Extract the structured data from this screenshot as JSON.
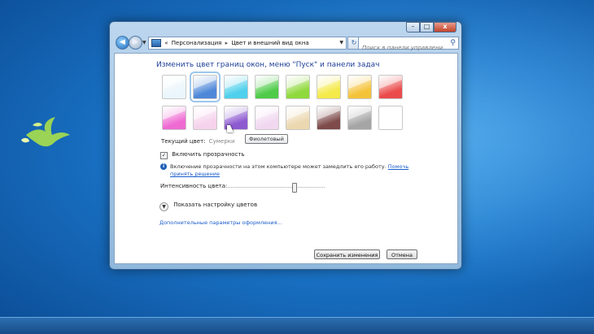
{
  "window": {
    "caption_buttons": {
      "minimize": "–",
      "maximize": "□",
      "close": "x"
    }
  },
  "navbar": {
    "back_glyph": "◀",
    "forward_glyph": "▶",
    "breadcrumb": [
      "«",
      "Персонализация",
      "Цвет и внешний вид окна"
    ],
    "breadcrumb_sep": "▸",
    "refresh_glyph": "↻",
    "search_placeholder": "Поиск в панели управления"
  },
  "content": {
    "heading": "Изменить цвет границ окон, меню \"Пуск\" и панели задач",
    "swatches": [
      {
        "color": "#eaf6fb"
      },
      {
        "color": "#4f88d8",
        "selected": true
      },
      {
        "color": "#4fd0ec"
      },
      {
        "color": "#4fcb49"
      },
      {
        "color": "#8fd93c"
      },
      {
        "color": "#f4ea4a"
      },
      {
        "color": "#f5c33a"
      },
      {
        "color": "#eb4b4b"
      },
      {
        "color": "#ef6bd3"
      },
      {
        "color": "#f6d2ec"
      },
      {
        "color": "#8d5ad0"
      },
      {
        "color": "#f1d8f0"
      },
      {
        "color": "#ecd8b0"
      },
      {
        "color": "#7e4a4a"
      },
      {
        "color": "#a5a5a5"
      },
      {
        "color": "#ffffff"
      }
    ],
    "tooltip": "Фиолетовый",
    "current_color_label": "Текущий цвет:",
    "current_color_value": "Сумерки",
    "transparency_label": "Включить прозрачность",
    "transparency_checked": true,
    "info_text": "Включение прозрачности на этом компьютере может замедлить его работу.",
    "info_link": "Помочь принять решение",
    "intensity_label": "Интенсивность цвета:",
    "intensity_value": 0.72,
    "show_settings_label": "Показать настройку цветов",
    "advanced_link": "Дополнительные параметры оформления...",
    "save_button": "Сохранить изменения",
    "cancel_button": "Отмена"
  }
}
